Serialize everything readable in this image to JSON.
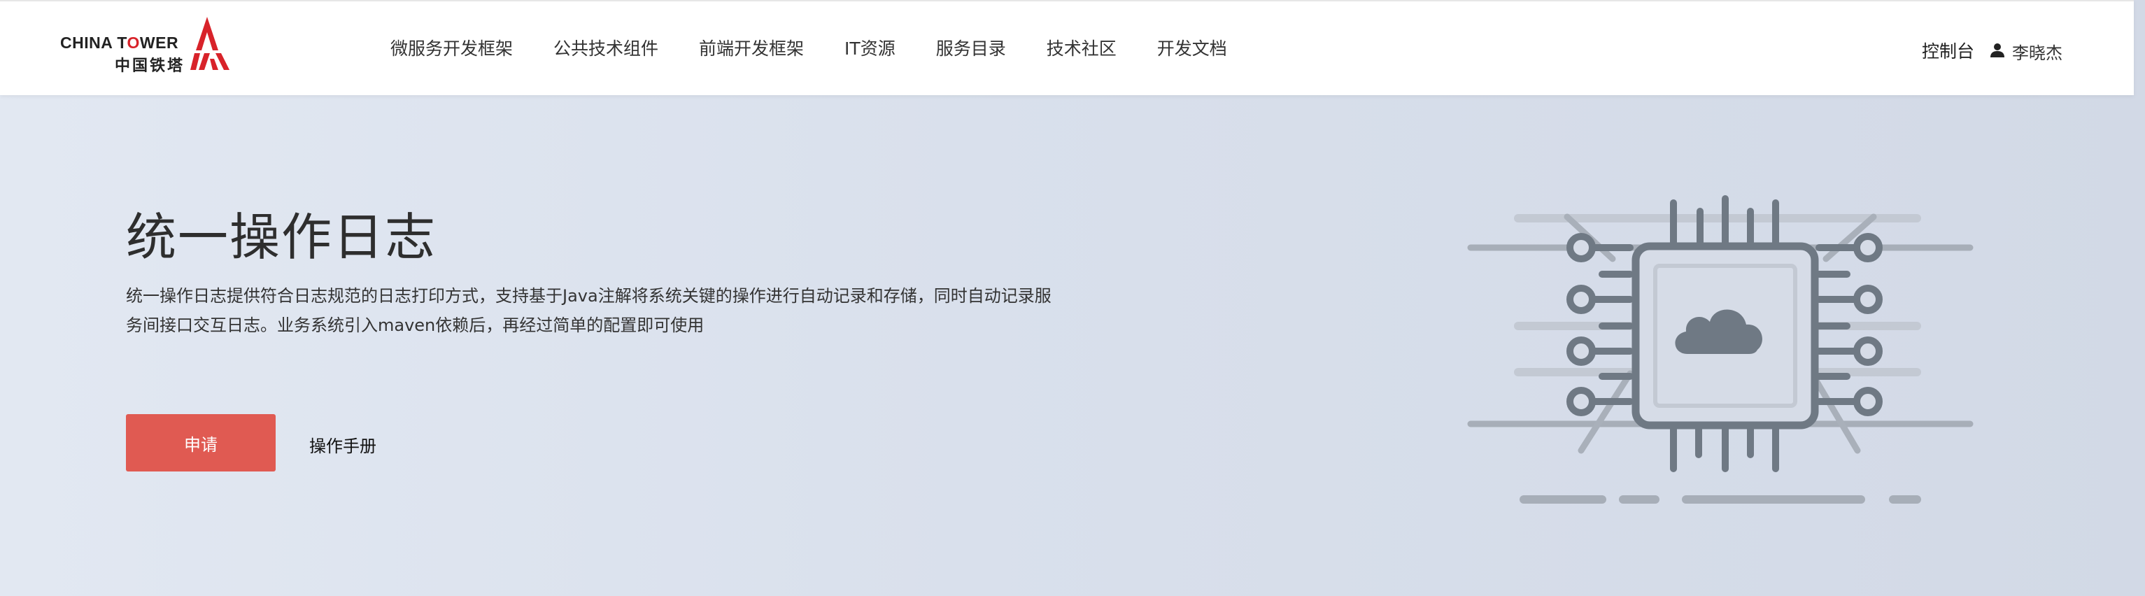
{
  "header": {
    "logo": {
      "en_left": "CHINA T",
      "en_red": "O",
      "en_right": "WER",
      "cn": "中国铁塔"
    },
    "nav": [
      {
        "label": "微服务开发框架"
      },
      {
        "label": "公共技术组件"
      },
      {
        "label": "前端开发框架"
      },
      {
        "label": "IT资源"
      },
      {
        "label": "服务目录"
      },
      {
        "label": "技术社区"
      },
      {
        "label": "开发文档"
      }
    ],
    "console_label": "控制台",
    "user_name": "李晓杰"
  },
  "hero": {
    "title": "统一操作日志",
    "description": "统一操作日志提供符合日志规范的日志打印方式，支持基于Java注解将系统关键的操作进行自动记录和存储，同时自动记录服务间接口交互日志。业务系统引入maven依赖后，再经过简单的配置即可使用",
    "apply_label": "申请",
    "manual_label": "操作手册"
  },
  "colors": {
    "brand_red": "#d8232a",
    "button_red": "#e05a52",
    "background": "#d9e0ec",
    "illustration_gray": "#707a85"
  },
  "icons": {
    "user": "user-icon",
    "illustration": "chip-cloud-illustration"
  }
}
